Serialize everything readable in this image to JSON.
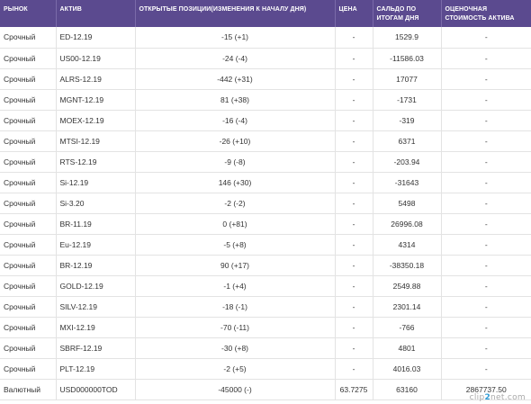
{
  "table": {
    "headers": {
      "market": "РЫНОК",
      "asset": "АКТИВ",
      "positions": "ОТКРЫТЫЕ ПОЗИЦИИ(ИЗМЕНЕНИЯ К НАЧАЛУ ДНЯ)",
      "price": "ЦЕНА",
      "balance": "САЛЬДО ПО ИТОГАМ ДНЯ",
      "valuation": "ОЦЕНОЧНАЯ СТОИМОСТЬ АКТИВА"
    },
    "rows": [
      {
        "market": "Срочный",
        "asset": "ED-12.19",
        "positions": "-15 (+1)",
        "price": "-",
        "balance": "1529.9",
        "valuation": "-"
      },
      {
        "market": "Срочный",
        "asset": "US00-12.19",
        "positions": "-24 (-4)",
        "price": "-",
        "balance": "-11586.03",
        "valuation": "-"
      },
      {
        "market": "Срочный",
        "asset": "ALRS-12.19",
        "positions": "-442 (+31)",
        "price": "-",
        "balance": "17077",
        "valuation": "-"
      },
      {
        "market": "Срочный",
        "asset": "MGNT-12.19",
        "positions": "81 (+38)",
        "price": "-",
        "balance": "-1731",
        "valuation": "-"
      },
      {
        "market": "Срочный",
        "asset": "MOEX-12.19",
        "positions": "-16 (-4)",
        "price": "-",
        "balance": "-319",
        "valuation": "-"
      },
      {
        "market": "Срочный",
        "asset": "MTSI-12.19",
        "positions": "-26 (+10)",
        "price": "-",
        "balance": "6371",
        "valuation": "-"
      },
      {
        "market": "Срочный",
        "asset": "RTS-12.19",
        "positions": "-9 (-8)",
        "price": "-",
        "balance": "-203.94",
        "valuation": "-"
      },
      {
        "market": "Срочный",
        "asset": "Si-12.19",
        "positions": "146 (+30)",
        "price": "-",
        "balance": "-31643",
        "valuation": "-"
      },
      {
        "market": "Срочный",
        "asset": "Si-3.20",
        "positions": "-2 (-2)",
        "price": "-",
        "balance": "5498",
        "valuation": "-"
      },
      {
        "market": "Срочный",
        "asset": "BR-11.19",
        "positions": "0 (+81)",
        "price": "-",
        "balance": "26996.08",
        "valuation": "-"
      },
      {
        "market": "Срочный",
        "asset": "Eu-12.19",
        "positions": "-5 (+8)",
        "price": "-",
        "balance": "4314",
        "valuation": "-"
      },
      {
        "market": "Срочный",
        "asset": "BR-12.19",
        "positions": "90 (+17)",
        "price": "-",
        "balance": "-38350.18",
        "valuation": "-"
      },
      {
        "market": "Срочный",
        "asset": "GOLD-12.19",
        "positions": "-1 (+4)",
        "price": "-",
        "balance": "2549.88",
        "valuation": "-"
      },
      {
        "market": "Срочный",
        "asset": "SILV-12.19",
        "positions": "-18 (-1)",
        "price": "-",
        "balance": "2301.14",
        "valuation": "-"
      },
      {
        "market": "Срочный",
        "asset": "MXI-12.19",
        "positions": "-70 (-11)",
        "price": "-",
        "balance": "-766",
        "valuation": "-"
      },
      {
        "market": "Срочный",
        "asset": "SBRF-12.19",
        "positions": "-30 (+8)",
        "price": "-",
        "balance": "4801",
        "valuation": "-"
      },
      {
        "market": "Срочный",
        "asset": "PLT-12.19",
        "positions": "-2 (+5)",
        "price": "-",
        "balance": "4016.03",
        "valuation": "-"
      },
      {
        "market": "Валютный",
        "asset": "USD000000TOD",
        "positions": "-45000 (-)",
        "price": "63.7275",
        "balance": "63160",
        "valuation": "2867737.50"
      }
    ]
  },
  "watermark": {
    "prefix": "clip",
    "accent": "2",
    "suffix": "net.com"
  }
}
